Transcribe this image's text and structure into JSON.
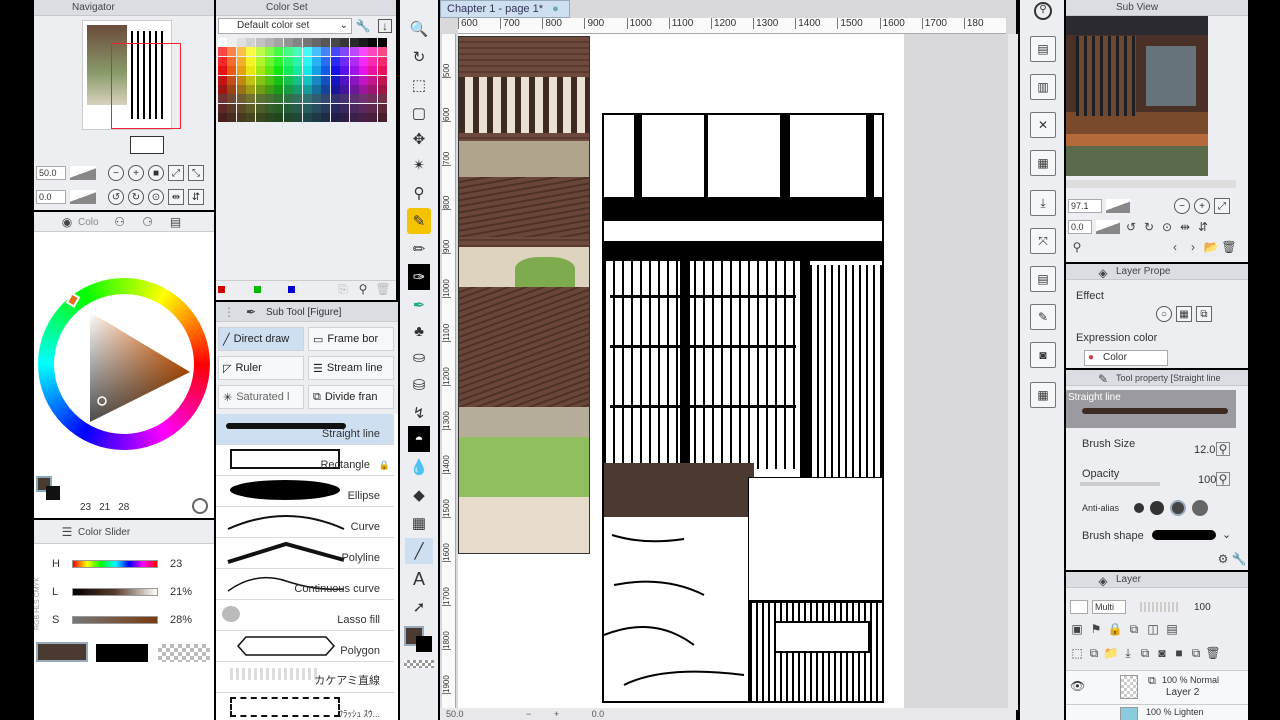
{
  "navigator": {
    "title": "Navigator",
    "zoom": "50.0",
    "rotate": "0.0"
  },
  "color_set": {
    "title": "Color Set",
    "dropdown": "Default color set"
  },
  "color_wheel": {
    "tab_label": "Colo",
    "values": [
      "23",
      "21",
      "28"
    ]
  },
  "color_slider": {
    "title": "Color Slider",
    "rows": [
      {
        "label": "H",
        "value": "23"
      },
      {
        "label": "L",
        "value": "21%"
      },
      {
        "label": "S",
        "value": "28%"
      }
    ],
    "side_tabs": "RGB HLS CMYK"
  },
  "sub_tool_figure": {
    "title": "Sub Tool [Figure]",
    "tabs": [
      "Direct draw",
      "Frame bor",
      "Ruler",
      "Stream line",
      "Saturated l",
      "Divide fran"
    ],
    "items": [
      "Straight line",
      "Rectangle",
      "Ellipse",
      "Curve",
      "Polyline",
      "Continuous curve",
      "Lasso fill",
      "Polygon",
      "カケアミ直線",
      "ﾌﾗｯｼｭ ｽｳ..."
    ]
  },
  "canvas": {
    "tab_title": "Chapter 1 - page 1*",
    "ruler_ticks": [
      "600",
      "700",
      "800",
      "900",
      "1000",
      "1100",
      "1200",
      "1300",
      "1400",
      "1500",
      "1600",
      "1700",
      "180"
    ],
    "vruler_ticks": [
      "500",
      "600",
      "700",
      "800",
      "900",
      "1000",
      "1100",
      "1200",
      "1300",
      "1400",
      "1500",
      "1600",
      "1700",
      "1800",
      "1900"
    ],
    "zoom": "50.0",
    "angle": "0.0"
  },
  "sub_view": {
    "title": "Sub View",
    "zoom": "97.1",
    "rotate": "0.0"
  },
  "layer_property": {
    "title": "Layer Prope",
    "effect_label": "Effect",
    "expression_label": "Expression color",
    "expression_value": "Color"
  },
  "tool_property": {
    "title": "Tool property [Straight line",
    "preset": "Straight line",
    "rows": [
      {
        "label": "Brush Size",
        "value": "12.0"
      },
      {
        "label": "Opacity",
        "value": "100"
      },
      {
        "label": "Anti-alias",
        "value": ""
      },
      {
        "label": "Brush shape",
        "value": ""
      }
    ]
  },
  "layer_panel": {
    "title": "Layer",
    "blend": "Multi",
    "opacity": "100",
    "layers": [
      {
        "mode": "100 % Normal",
        "name": "Layer 2"
      },
      {
        "mode": "100 % Lighten",
        "name": ""
      }
    ]
  },
  "colors": {
    "main": "#4a3a32",
    "accent": "#f5c400",
    "palette_bg": "#eceef1"
  }
}
